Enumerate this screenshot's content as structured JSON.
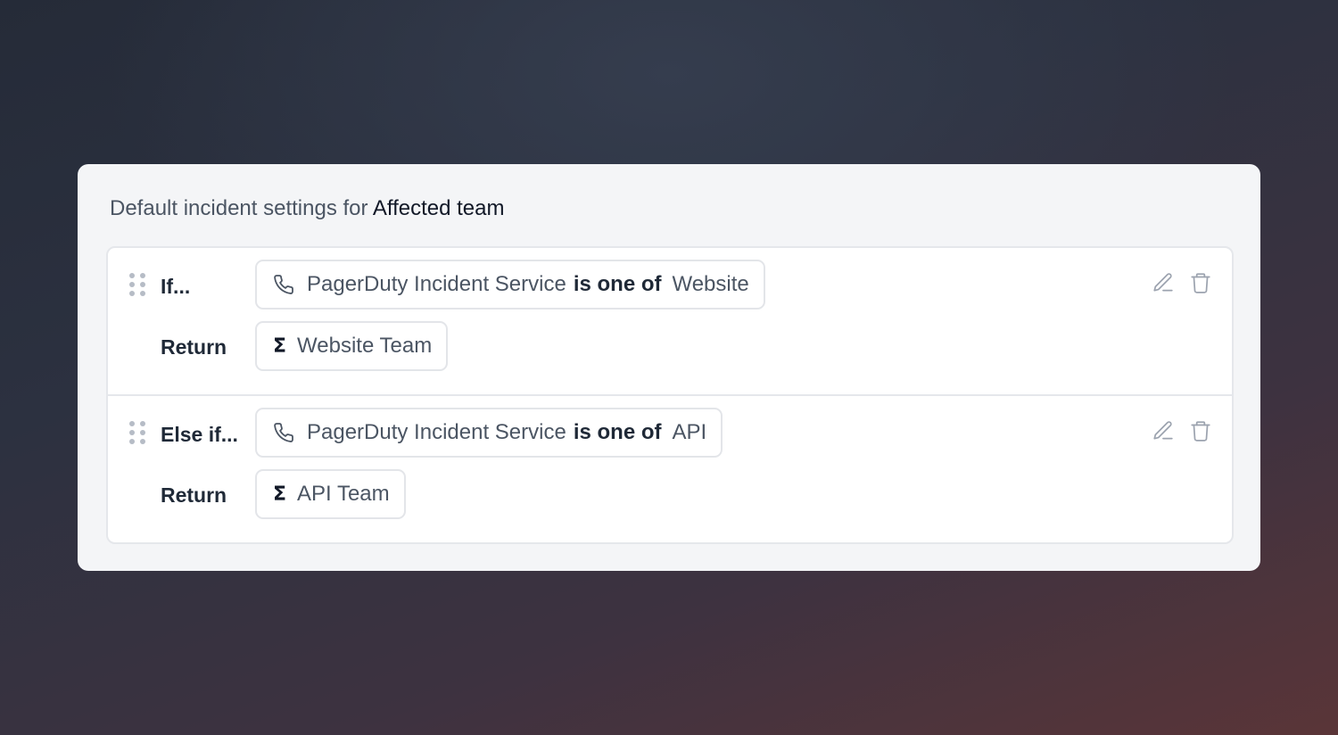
{
  "heading": {
    "prefix": "Default incident settings for",
    "field": "Affected team"
  },
  "rules": [
    {
      "keyword": "If...",
      "condition": {
        "icon": "phone-icon",
        "field": "PagerDuty Incident Service",
        "operator": "is one of",
        "value": "Website"
      },
      "return_keyword": "Return",
      "return": {
        "icon": "sigma-icon",
        "symbol": "Σ",
        "value": "Website Team"
      }
    },
    {
      "keyword": "Else if...",
      "condition": {
        "icon": "phone-icon",
        "field": "PagerDuty Incident Service",
        "operator": "is one of",
        "value": "API"
      },
      "return_keyword": "Return",
      "return": {
        "icon": "sigma-icon",
        "symbol": "Σ",
        "value": "API Team"
      }
    }
  ],
  "colors": {
    "card_bg": "#f4f5f7",
    "text_muted": "#4b5563",
    "text_strong": "#111827",
    "icon_gray": "#9ca3af"
  }
}
